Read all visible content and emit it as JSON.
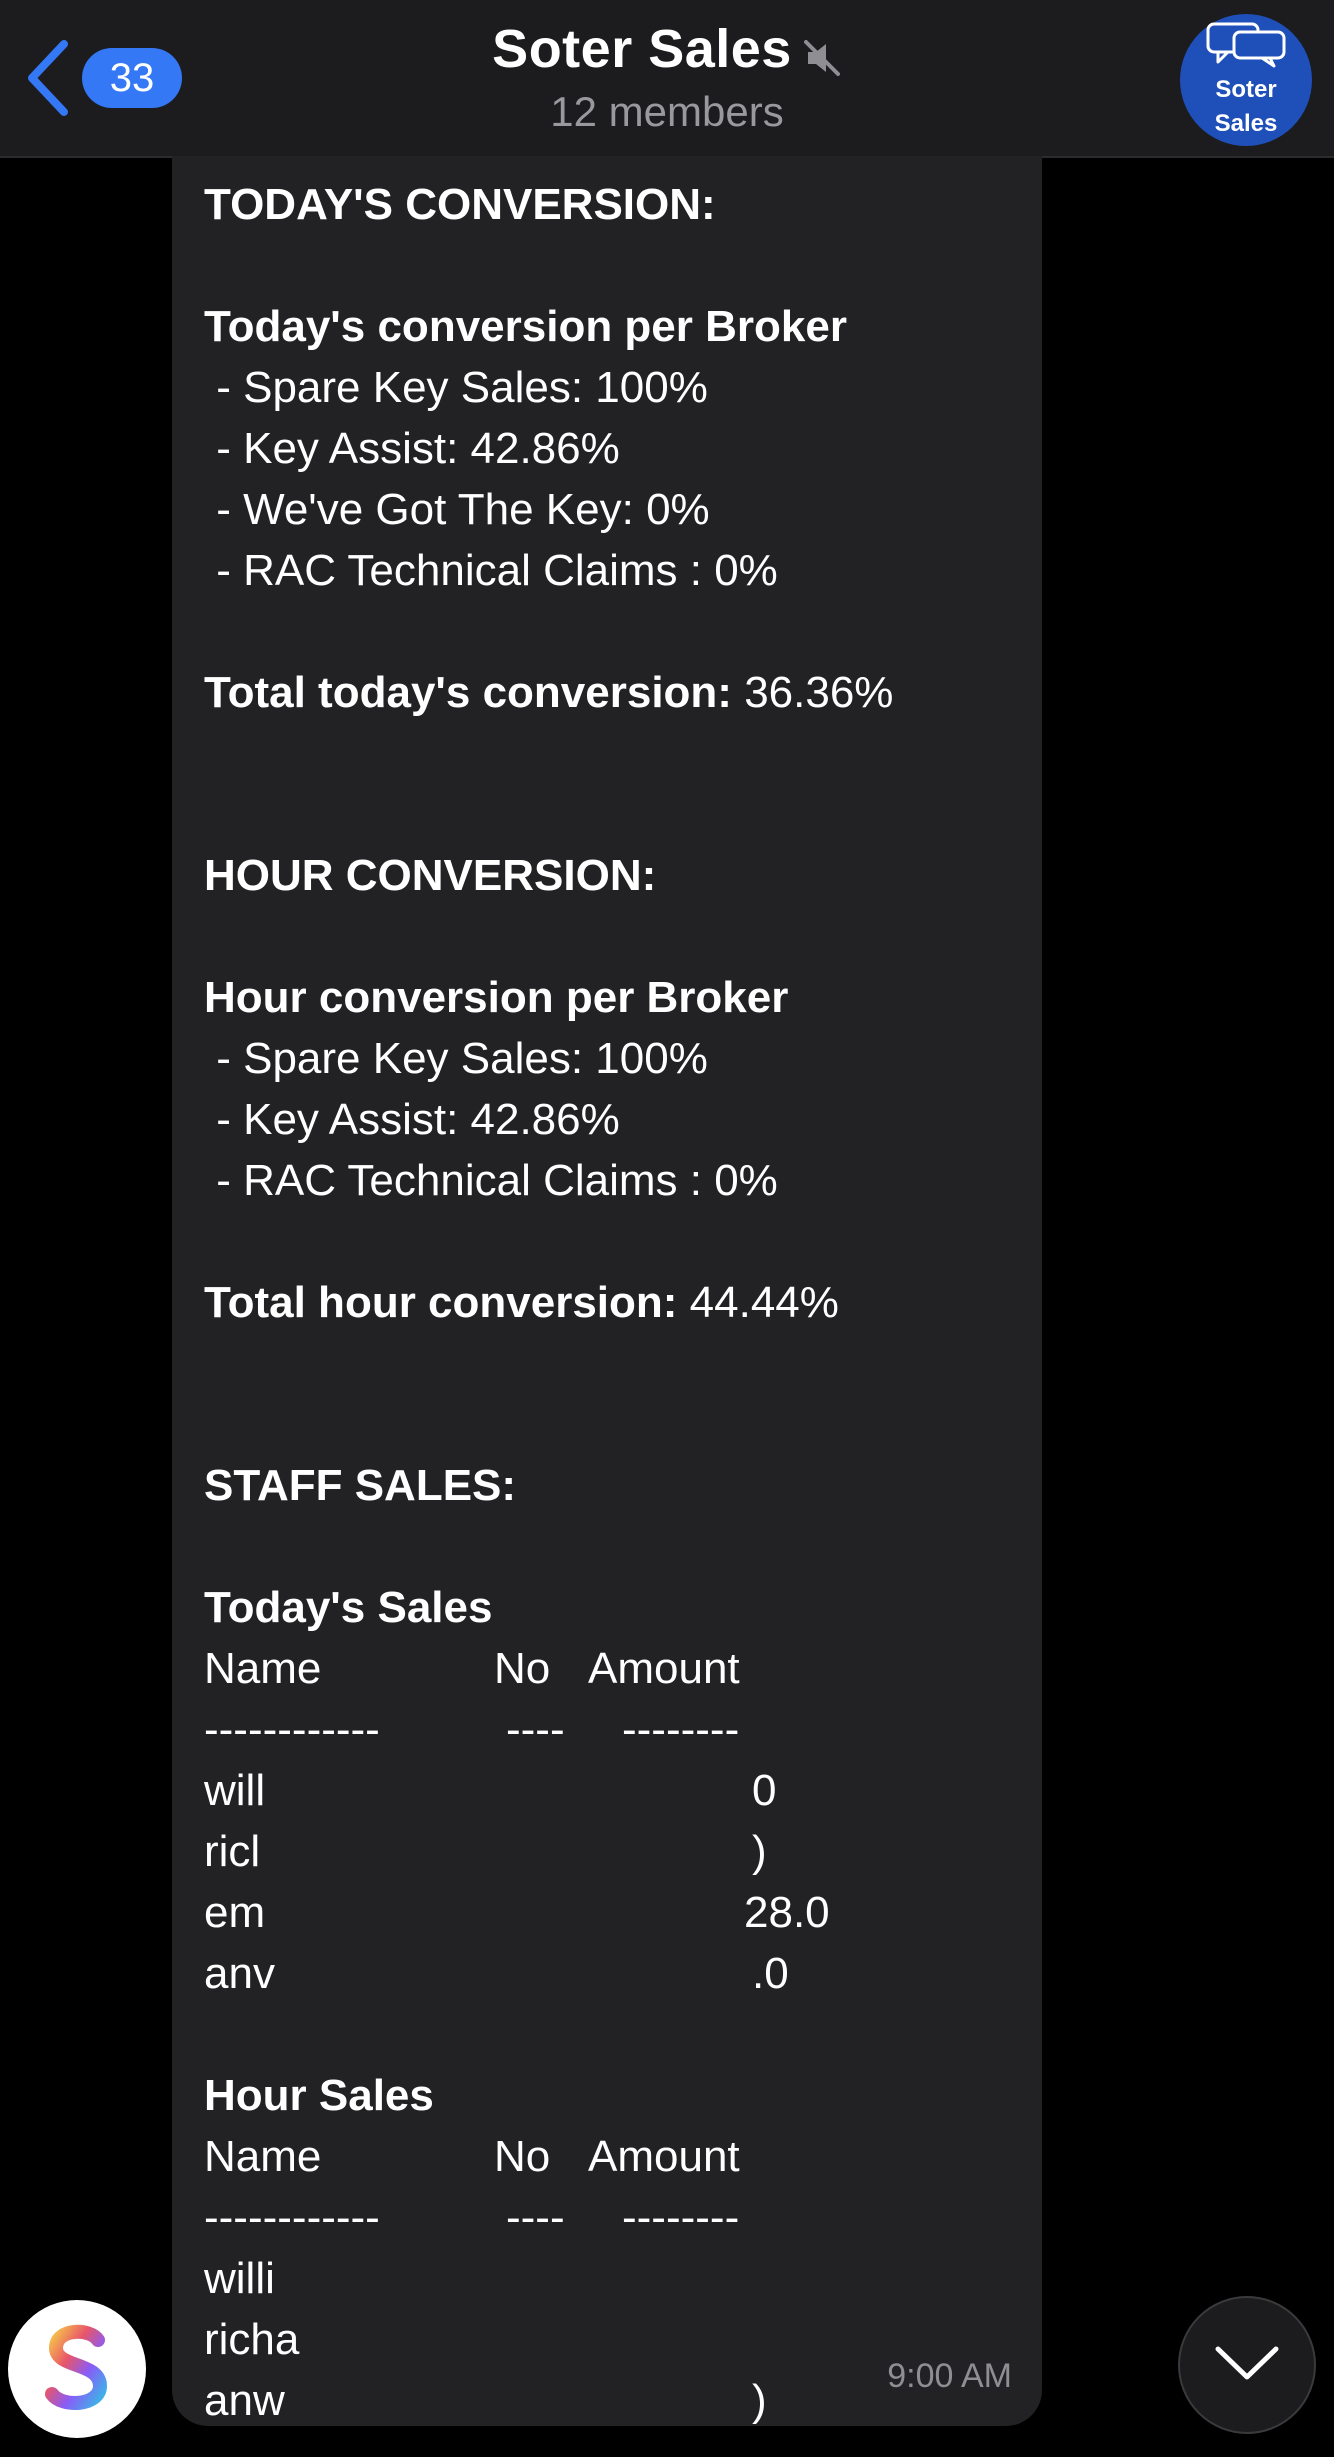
{
  "header": {
    "back_badge": "33",
    "title": "Soter Sales",
    "subtitle": "12 members",
    "avatar_line1": "Soter",
    "avatar_line2": "Sales",
    "icons": [
      "chevron-left-icon",
      "mute-icon",
      "chat-bubbles-icon"
    ]
  },
  "message": {
    "lines": [
      {
        "text": "TODAY'S CONVERSION:",
        "bold": true
      },
      {
        "text": "",
        "bold": false
      },
      {
        "text": "Today's conversion per Broker",
        "bold": true
      },
      {
        "text": " - Spare Key Sales: 100%",
        "bold": false
      },
      {
        "text": " - Key Assist: 42.86%",
        "bold": false
      },
      {
        "text": " - We've Got The Key: 0%",
        "bold": false
      },
      {
        "text": " - RAC Technical Claims : 0%",
        "bold": false
      },
      {
        "text": "",
        "bold": false
      },
      {
        "text": "Total today's conversion:",
        "bold": true,
        "value": " 36.36%"
      },
      {
        "text": "",
        "bold": false
      },
      {
        "text": "",
        "bold": false
      },
      {
        "text": "HOUR CONVERSION:",
        "bold": true
      },
      {
        "text": "",
        "bold": false
      },
      {
        "text": "Hour conversion per Broker",
        "bold": true
      },
      {
        "text": " - Spare Key Sales: 100%",
        "bold": false
      },
      {
        "text": " - Key Assist: 42.86%",
        "bold": false
      },
      {
        "text": " - RAC Technical Claims : 0%",
        "bold": false
      },
      {
        "text": "",
        "bold": false
      },
      {
        "text": "Total hour conversion:",
        "bold": true,
        "value": " 44.44%"
      },
      {
        "text": "",
        "bold": false
      },
      {
        "text": "",
        "bold": false
      },
      {
        "text": "STAFF SALES:",
        "bold": true
      },
      {
        "text": "",
        "bold": false
      },
      {
        "text": "Today's Sales",
        "bold": true
      }
    ],
    "todays_sales_table": {
      "header": [
        "Name",
        "No",
        "Amount"
      ],
      "divider": [
        "------------",
        "----",
        "--------"
      ],
      "rows": [
        {
          "name": "will",
          "amount": "0"
        },
        {
          "name": "ricl",
          "amount": ")"
        },
        {
          "name": "em",
          "amount": "28.0"
        },
        {
          "name": "anv",
          "amount": ".0"
        }
      ]
    },
    "hour_sales_title": "Hour Sales",
    "hour_sales_table": {
      "header": [
        "Name",
        "No",
        "Amount"
      ],
      "divider": [
        "------------",
        "----",
        "--------"
      ],
      "rows": [
        {
          "name": "willi",
          "amount": ""
        },
        {
          "name": "richa",
          "amount": ""
        },
        {
          "name": "anw",
          "amount": ")"
        }
      ]
    },
    "timestamp": "9:00 AM"
  },
  "colors": {
    "background": "#000000",
    "header_bg": "#1c1c1e",
    "bubble_bg": "#222224",
    "accent": "#3478f6",
    "avatar_bg": "#1f4fb8",
    "muted_text": "#98989d"
  }
}
